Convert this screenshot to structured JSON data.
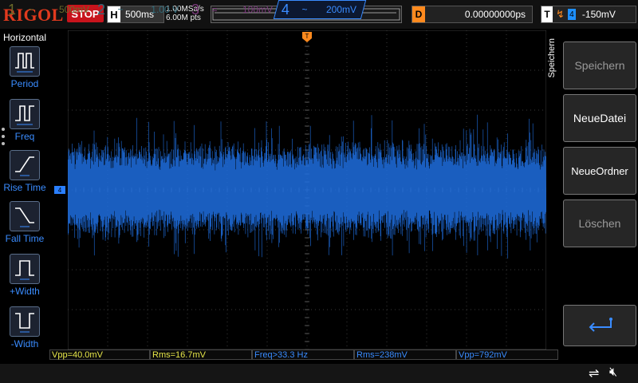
{
  "top": {
    "brand": "RIGOL",
    "run_state": "STOP",
    "timebase_letter": "H",
    "timebase": "500ms",
    "sample_rate": "1.00MSa/s",
    "mem_depth": "6.00M pts",
    "trigger_pos_marker": "T",
    "delay_letter": "D",
    "delay": "0.00000000ps",
    "trigger_letter": "T",
    "trigger_edge": "↯",
    "trigger_source": "4",
    "trigger_level": "-150mV"
  },
  "left_menu": {
    "title": "Horizontal",
    "items": [
      {
        "label": "Period",
        "icon": "period-icon"
      },
      {
        "label": "Freq",
        "icon": "freq-icon"
      },
      {
        "label": "Rise Time",
        "icon": "rise-time-icon"
      },
      {
        "label": "Fall Time",
        "icon": "fall-time-icon"
      },
      {
        "label": "+Width",
        "icon": "positive-width-icon"
      },
      {
        "label": "-Width",
        "icon": "negative-width-icon"
      }
    ]
  },
  "measurements": [
    {
      "text": "Vpp=40.0mV",
      "color": "#e8e84a"
    },
    {
      "text": "Rms=16.7mV",
      "color": "#e8e84a"
    },
    {
      "text": "Freq>33.3 Hz",
      "color": "#3a8cff"
    },
    {
      "text": "Rms=238mV",
      "color": "#3a8cff"
    },
    {
      "text": "Vpp=792mV",
      "color": "#3a8cff"
    }
  ],
  "right_menu": {
    "section_label": "Speichern",
    "buttons": [
      {
        "label": "Speichern",
        "state": "dim"
      },
      {
        "label": "NeueDatei",
        "state": "bright"
      },
      {
        "label": "NeueOrdner",
        "state": "bright"
      },
      {
        "label": "Löschen",
        "state": "dim"
      },
      {
        "label": "",
        "state": "return",
        "icon": "return-arrow-icon"
      }
    ]
  },
  "channels": [
    {
      "num": "1",
      "coupling": "~",
      "scale": "500mV",
      "color": "#e8e84a",
      "active": false
    },
    {
      "num": "2",
      "coupling": "~",
      "scale": "1.00 V",
      "color": "#3ec8e8",
      "active": false
    },
    {
      "num": "3",
      "coupling": "=",
      "scale": "100mV",
      "color": "#e03ae0",
      "active": false
    },
    {
      "num": "4",
      "coupling": "~",
      "scale": "200mV",
      "color": "#3a8cff",
      "active": true
    }
  ],
  "ch4_marker": "4",
  "colors": {
    "trace": "#1e6fe0",
    "trigger": "#ff8a1e",
    "grid": "#3a3a3a"
  }
}
